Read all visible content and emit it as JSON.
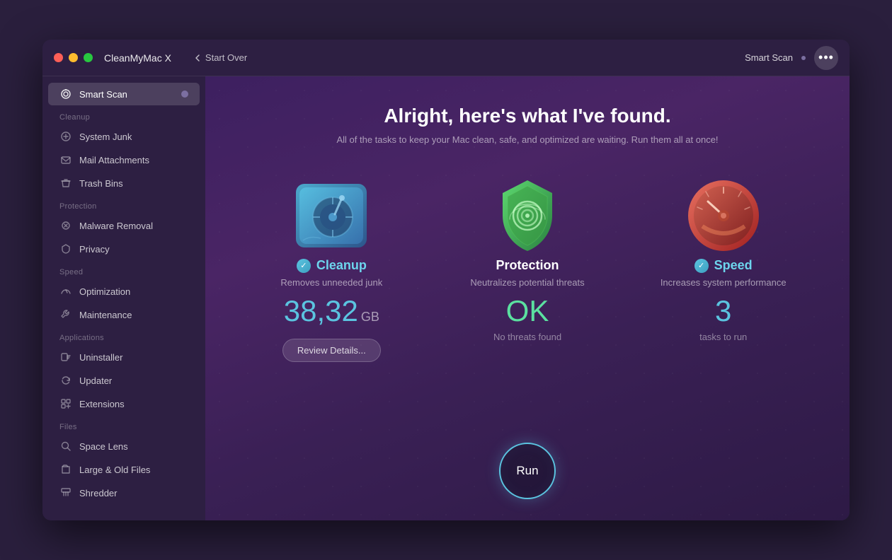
{
  "window": {
    "app_name": "CleanMyMac X",
    "start_over": "Start Over",
    "scan_label": "Smart Scan",
    "more_button": "•••"
  },
  "sidebar": {
    "smart_scan": "Smart Scan",
    "sections": [
      {
        "label": "Cleanup",
        "items": [
          {
            "id": "system-junk",
            "label": "System Junk",
            "icon": "gear"
          },
          {
            "id": "mail-attachments",
            "label": "Mail Attachments",
            "icon": "mail"
          },
          {
            "id": "trash-bins",
            "label": "Trash Bins",
            "icon": "trash"
          }
        ]
      },
      {
        "label": "Protection",
        "items": [
          {
            "id": "malware-removal",
            "label": "Malware Removal",
            "icon": "bio"
          },
          {
            "id": "privacy",
            "label": "Privacy",
            "icon": "privacy"
          }
        ]
      },
      {
        "label": "Speed",
        "items": [
          {
            "id": "optimization",
            "label": "Optimization",
            "icon": "speed"
          },
          {
            "id": "maintenance",
            "label": "Maintenance",
            "icon": "maintenance"
          }
        ]
      },
      {
        "label": "Applications",
        "items": [
          {
            "id": "uninstaller",
            "label": "Uninstaller",
            "icon": "uninstall"
          },
          {
            "id": "updater",
            "label": "Updater",
            "icon": "updater"
          },
          {
            "id": "extensions",
            "label": "Extensions",
            "icon": "extensions"
          }
        ]
      },
      {
        "label": "Files",
        "items": [
          {
            "id": "space-lens",
            "label": "Space Lens",
            "icon": "space"
          },
          {
            "id": "large-old-files",
            "label": "Large & Old Files",
            "icon": "files"
          },
          {
            "id": "shredder",
            "label": "Shredder",
            "icon": "shredder"
          }
        ]
      }
    ]
  },
  "main": {
    "title": "Alright, here's what I've found.",
    "subtitle": "All of the tasks to keep your Mac clean, safe, and optimized are waiting. Run them all at once!",
    "cards": [
      {
        "id": "cleanup",
        "title": "Cleanup",
        "has_check": true,
        "desc": "Removes unneeded junk",
        "value": "38,32",
        "unit": "GB",
        "sublabel": "",
        "has_review": true,
        "review_label": "Review Details..."
      },
      {
        "id": "protection",
        "title": "Protection",
        "has_check": false,
        "desc": "Neutralizes potential threats",
        "value": "OK",
        "unit": "",
        "sublabel": "No threats found",
        "has_review": false
      },
      {
        "id": "speed",
        "title": "Speed",
        "has_check": true,
        "desc": "Increases system performance",
        "value": "3",
        "unit": "",
        "sublabel": "tasks to run",
        "has_review": false
      }
    ],
    "run_button": "Run"
  }
}
